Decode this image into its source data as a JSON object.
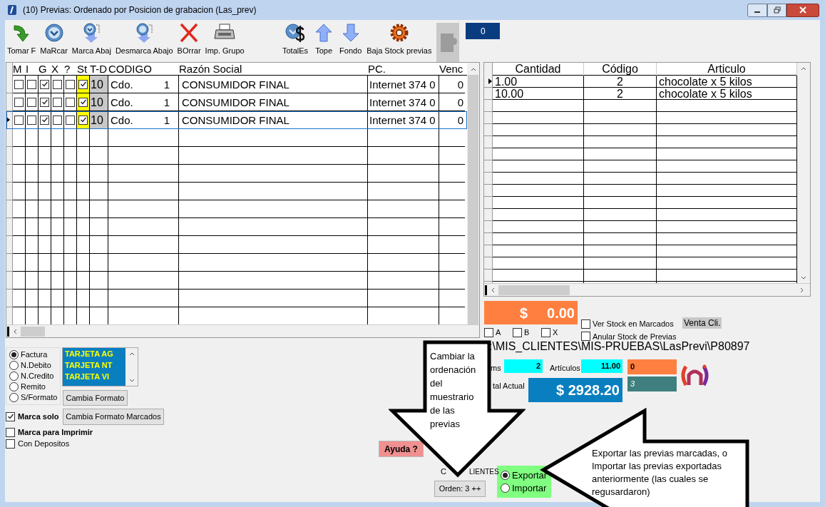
{
  "window": {
    "title": "(10) Previas: Ordenado por Posicion de grabacion (Las_prev)"
  },
  "toolbar": {
    "groups": [
      [
        {
          "kind": "take",
          "label": "Tomar F",
          "disabled": false
        },
        {
          "kind": "mark",
          "label": "MaRcar",
          "disabled": false
        },
        {
          "kind": "mark-down",
          "label": "Marca Abaj",
          "disabled": false
        },
        {
          "kind": "unmark-down",
          "label": "Desmarca Abajo",
          "disabled": false
        },
        {
          "kind": "delete",
          "label": "BOrrar",
          "disabled": false
        },
        {
          "kind": "print",
          "label": "Imp. Grupo",
          "disabled": false
        }
      ],
      [
        {
          "kind": "totals",
          "label": "TotalEs",
          "disabled": false
        },
        {
          "kind": "top",
          "label": "Tope",
          "disabled": false
        },
        {
          "kind": "bottom",
          "label": "Fondo",
          "disabled": false
        },
        {
          "kind": "stock",
          "label": "Baja Stock previas",
          "disabled": false
        },
        {
          "kind": "blank",
          "disabled": true
        }
      ]
    ],
    "counter": "0"
  },
  "previas": {
    "columns": [
      "M",
      "I",
      "G",
      "X",
      "?",
      "St",
      "T-D",
      "CODIGO",
      "Razón Social",
      "PC.",
      "Venc"
    ],
    "rows": [
      {
        "checks": [
          false,
          false,
          true,
          false,
          false,
          true
        ],
        "td": "10",
        "codigo": "Cdo.",
        "numero": "1",
        "razon_social": "CONSUMIDOR FINAL",
        "pc": "Internet 374 0",
        "venc": "0",
        "current": false
      },
      {
        "checks": [
          false,
          false,
          true,
          false,
          false,
          true
        ],
        "td": "10",
        "codigo": "Cdo.",
        "numero": "1",
        "razon_social": "CONSUMIDOR FINAL",
        "pc": "Internet 374 0",
        "venc": "0",
        "current": false
      },
      {
        "checks": [
          false,
          false,
          true,
          false,
          false,
          true
        ],
        "td": "10",
        "codigo": "Cdo.",
        "numero": "1",
        "razon_social": "CONSUMIDOR FINAL",
        "pc": "Internet 374 0",
        "venc": "0",
        "current": true
      }
    ]
  },
  "detalle": {
    "columns": [
      "Cantidad",
      "Código",
      "Articulo"
    ],
    "rows": [
      {
        "cantidad": "1.00",
        "codigo": "2",
        "articulo": "chocolate x 5 kilos",
        "current": true
      },
      {
        "cantidad": "10.00",
        "codigo": "2",
        "articulo": "chocolate x 5 kilos",
        "current": false
      }
    ]
  },
  "marked_total": {
    "currency": "$",
    "amount": "0.00"
  },
  "letter_filters": [
    {
      "label": "A",
      "checked": false
    },
    {
      "label": "B",
      "checked": false
    },
    {
      "label": "X",
      "checked": false
    }
  ],
  "stock_options": [
    {
      "label": "Ver Stock en Marcados",
      "checked": false
    },
    {
      "label": "Anular Stock de Previas",
      "checked": false
    }
  ],
  "venta_cli": "Venta Cli.",
  "path": ":\\MIS_CLIENTES\\MIS-PRUEBAS\\LasPrevi\\P80897",
  "summary": {
    "items_label": "ms",
    "items_value": "2",
    "articulos_label": "Artículos",
    "articulos_value": "11.00",
    "counter_orange": "0",
    "counter_teal": "3",
    "total_label": "tal Actual",
    "total_value": "$ 2928.20"
  },
  "format": {
    "radios": [
      {
        "label": "Factura",
        "selected": true
      },
      {
        "label": "N.Debito",
        "selected": false
      },
      {
        "label": "N.Credito",
        "selected": false
      },
      {
        "label": "Remito",
        "selected": false
      },
      {
        "label": "S/Formato",
        "selected": false
      }
    ],
    "list": [
      "TARJETA AG",
      "TARJETA NT",
      "TARJETA VI"
    ],
    "buttons": [
      "Cambia Formato",
      "Cambia Formato Marcados"
    ]
  },
  "marca_options": [
    {
      "label": "Marca solo",
      "checked": true,
      "bold": true
    },
    {
      "label": "Marca para Imprimir",
      "checked": false,
      "bold": true
    },
    {
      "label": "Con Depositos",
      "checked": false,
      "bold": false
    }
  ],
  "help_button": "Ayuda ?",
  "clientes_label": [
    "C",
    "LIENTES"
  ],
  "order_button": "Orden: 3 ++",
  "transfer": [
    {
      "label": "Exportar",
      "selected": true
    },
    {
      "label": "Importar",
      "selected": false
    }
  ],
  "callouts": [
    {
      "kind": "down",
      "text": "Cambiar la ordenación del muestrario de las previas"
    },
    {
      "kind": "left",
      "text": "Exportar las previas marcadas, o Importar las previas exportadas anteriormente (las cuales se regusardaron)"
    }
  ]
}
